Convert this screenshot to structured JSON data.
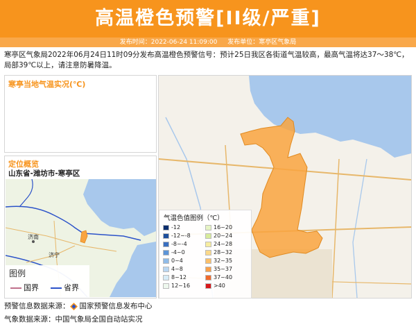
{
  "header": {
    "title": "高温橙色预警[II级/严重]",
    "publish_time": "发布时间：2022-06-24 11:09:00",
    "publisher": "发布单位：寒亭区气象局"
  },
  "description": "寒亭区气象局2022年06月24日11时09分发布高温橙色预警信号：预计25日我区各街道气温较高，最高气温将达37～38℃，局部39℃以上，请注意防暑降温。",
  "temperature_panel": {
    "title": "寒亭当地气温实况(℃)"
  },
  "location_panel": {
    "title": "定位概览",
    "path": "山东省-潍坊市-寒亭区",
    "map_labels": [
      "济南",
      "济宁"
    ]
  },
  "loc_legend": {
    "title": "图例",
    "items": [
      {
        "label": "国界",
        "color": "#c0708a"
      },
      {
        "label": "省界",
        "color": "#2b52c9"
      }
    ]
  },
  "color_legend": {
    "title": "气温色值图例（℃）",
    "left": [
      {
        "label": "-12",
        "color": "#0b2e6e"
      },
      {
        "label": "-12~-8",
        "color": "#1e4f9c"
      },
      {
        "label": "-8~-4",
        "color": "#3a6fc0"
      },
      {
        "label": "-4~0",
        "color": "#5d95d8"
      },
      {
        "label": "0~4",
        "color": "#8fbbe8"
      },
      {
        "label": "4~8",
        "color": "#b9d7f2"
      },
      {
        "label": "8~12",
        "color": "#d7ecf7"
      },
      {
        "label": "12~16",
        "color": "#eef8ee"
      }
    ],
    "right": [
      {
        "label": "16~20",
        "color": "#e6f4c5"
      },
      {
        "label": "20~24",
        "color": "#d7ec9c"
      },
      {
        "label": "24~28",
        "color": "#f7eda0"
      },
      {
        "label": "28~32",
        "color": "#fbd98a"
      },
      {
        "label": "32~35",
        "color": "#fbc06a"
      },
      {
        "label": "35~37",
        "color": "#f9a04a"
      },
      {
        "label": "37~40",
        "color": "#f06a2c"
      },
      {
        "label": ">40",
        "color": "#d7191c"
      }
    ]
  },
  "sources": {
    "warning_label": "预警信息数据来源：",
    "warning_value": "国家预警信息发布中心",
    "weather_label": "气象数据来源：",
    "weather_value": "中国气象局全国自动站实况"
  },
  "colors": {
    "accent": "#f7941d",
    "meta_bar": "#f9a84a",
    "region_fill": "#f9a440",
    "sea": "#a8c8ec"
  }
}
